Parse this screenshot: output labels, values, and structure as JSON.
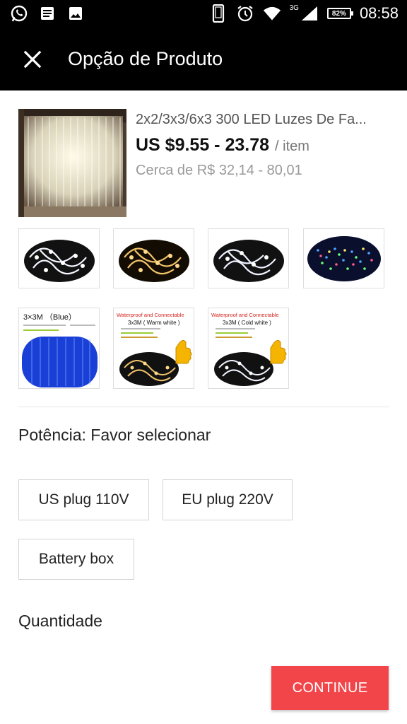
{
  "status_bar": {
    "network": "3G",
    "battery": "82%",
    "time": "08:58"
  },
  "app_bar": {
    "title": "Opção de Produto"
  },
  "product": {
    "title": "2x2/3x3/6x3 300 LED Luzes De Fa...",
    "price": "US $9.55 - 23.78",
    "per_item": "/ item",
    "approx": "Cerca de R$ 32,14 - 80,01"
  },
  "thumbnails": [
    {
      "style": "cold-white-coil",
      "selected": false
    },
    {
      "style": "warm-white-coil",
      "selected": false
    },
    {
      "style": "cold-white-coil",
      "selected": false
    },
    {
      "style": "multicolor-curtain",
      "selected": false
    },
    {
      "style": "blue-card",
      "title": "3×3M （Blue）",
      "selected": false
    },
    {
      "style": "warm-card",
      "title": "Waterproof and Connectable",
      "subtitle": "3x3M ( Warm white )",
      "selected": false
    },
    {
      "style": "cold-card",
      "title": "Waterproof and Connectable",
      "subtitle": "3x3M ( Cold white )",
      "selected": false
    }
  ],
  "power": {
    "label": "Potência: Favor selecionar",
    "options": [
      "US plug 110V",
      "EU plug 220V",
      "Battery box"
    ]
  },
  "quantity": {
    "label": "Quantidade"
  },
  "continue_label": "CONTINUE",
  "colors": {
    "accent": "#f2454a",
    "appbar": "#000000"
  }
}
